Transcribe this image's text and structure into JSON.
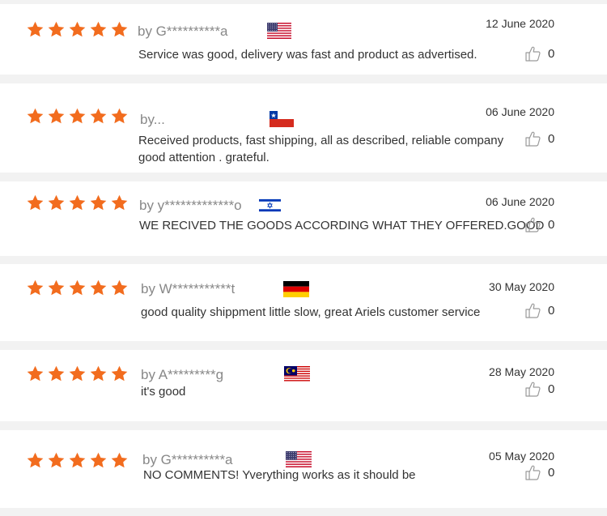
{
  "colors": {
    "star": "#f26c1e",
    "page_bg": "#f2f2f2",
    "card_bg": "#ffffff",
    "author": "#888888"
  },
  "reviews": [
    {
      "stars": 5,
      "author": "by G**********a",
      "flag": "us-flag",
      "date": "12 June 2020",
      "text": "Service was good, delivery was fast and product as advertised.",
      "likes": "0"
    },
    {
      "stars": 5,
      "author": "by...",
      "flag": "chile-flag",
      "date": "06 June 2020",
      "text": "Received products, fast shipping, all as described, reliable company good attention . grateful.",
      "likes": "0"
    },
    {
      "stars": 5,
      "author": "by y*************o",
      "flag": "israel-flag",
      "date": "06 June 2020",
      "text": "WE RECIVED THE GOODS ACCORDING WHAT THEY OFFERED.GOOD",
      "likes": "0"
    },
    {
      "stars": 5,
      "author": "by W***********t",
      "flag": "germany-flag",
      "date": "30 May 2020",
      "text": "good quality shippment little slow, great Ariels customer service",
      "likes": "0"
    },
    {
      "stars": 5,
      "author": "by A*********g",
      "flag": "malaysia-flag",
      "date": "28 May 2020",
      "text": "it's good",
      "likes": "0"
    },
    {
      "stars": 5,
      "author": "by G**********a",
      "flag": "us-flag",
      "date": "05 May 2020",
      "text": "NO COMMENTS! Yverything works as it should be",
      "likes": "0"
    }
  ]
}
